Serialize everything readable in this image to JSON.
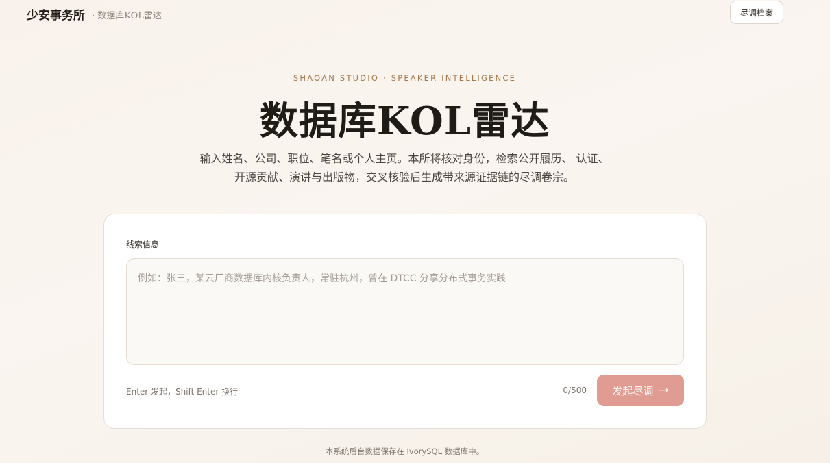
{
  "header": {
    "brand": "少安事务所",
    "subtitle": "· 数据库KOL雷达",
    "archive_button": "尽调档案"
  },
  "hero": {
    "eyebrow": "SHAOAN STUDIO · SPEAKER INTELLIGENCE",
    "title": "数据库KOL雷达",
    "lead_line1": "输入姓名、公司、职位、笔名或个人主页。本所将核对身份，检索公开履历、 认证、",
    "lead_line2": "开源贡献、演讲与出版物，交叉核验后生成带来源证据链的尽调卷宗。"
  },
  "form": {
    "label": "线索信息",
    "input_value": "",
    "placeholder": "例如：张三，某云厂商数据库内核负责人，常驻杭州，曾在 DTCC 分享分布式事务实践",
    "hint": "Enter 发起，Shift Enter 换行",
    "counter": "0/500",
    "submit_label": "发起尽调",
    "submit_icon": "→"
  },
  "footer": {
    "note": "本系统后台数据保存在 IvorySQL 数据库中。"
  },
  "colors": {
    "accent": "#e09c93",
    "eyebrow": "#a4784a",
    "background": "#f9f2ec"
  }
}
